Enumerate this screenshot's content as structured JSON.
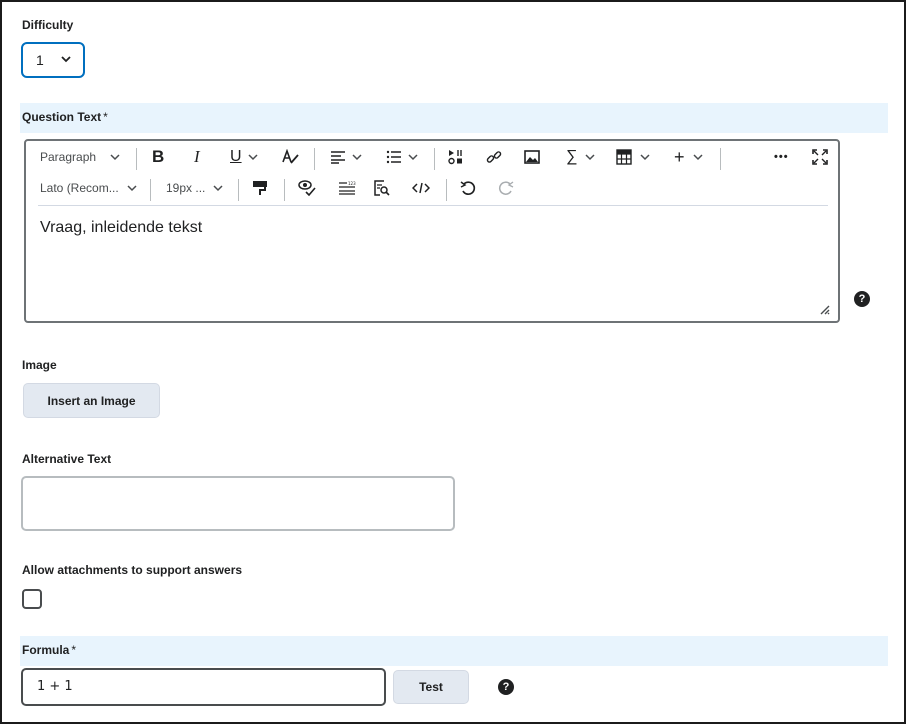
{
  "difficulty": {
    "label": "Difficulty",
    "value": "1"
  },
  "question_text": {
    "label": "Question Text",
    "required_mark": "*",
    "toolbar": {
      "paragraph": "Paragraph",
      "font": "Lato (Recom...",
      "size": "19px ...",
      "bold": "B",
      "italic": "I",
      "underline": "U",
      "more": "•••",
      "sigma": "∑",
      "plus": "+"
    },
    "content": "Vraag, inleidende tekst"
  },
  "image": {
    "label": "Image",
    "button": "Insert an Image"
  },
  "alt_text": {
    "label": "Alternative Text",
    "value": ""
  },
  "attachments": {
    "label": "Allow attachments to support answers",
    "checked": false
  },
  "formula": {
    "label": "Formula",
    "required_mark": "*",
    "value": "1 + 1",
    "test_button": "Test"
  },
  "colors": {
    "focus_blue": "#006fbf",
    "band": "#e8f4fd",
    "button": "#e3e9f1"
  }
}
